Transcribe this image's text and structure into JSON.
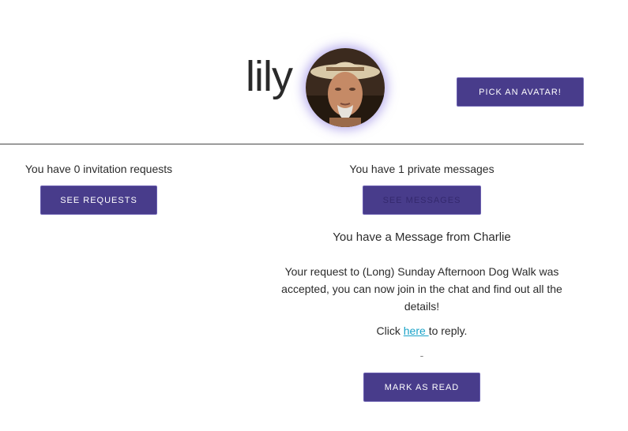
{
  "header": {
    "username": "lily",
    "avatar_icon": "user-avatar-photo",
    "pick_avatar_label": "PICK AN AVATAR!"
  },
  "invitations": {
    "count_text": "You have 0 invitation requests",
    "see_requests_label": "SEE REQUESTS"
  },
  "messages": {
    "count_text": "You have 1 private messages",
    "see_messages_label": "SEE MESSAGES",
    "message_from": "You have a Message from Charlie",
    "message_body": "Your request to (Long) Sunday Afternoon Dog Walk was accepted, you can now join in the chat and find out all the details!",
    "click_prefix": "Click ",
    "here_link": "here ",
    "click_suffix": "to reply.",
    "separator": "-",
    "mark_read_label": "MARK AS READ"
  },
  "colors": {
    "button_bg": "#483c8b",
    "link": "#1aa3c8",
    "avatar_glow": "#7864dc"
  }
}
